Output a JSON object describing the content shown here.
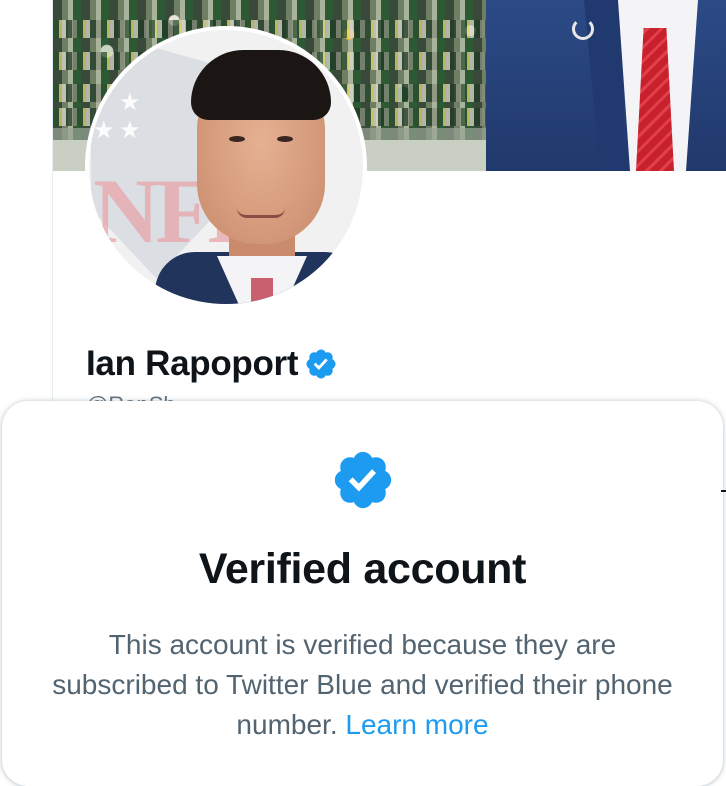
{
  "profile": {
    "name": "Ian Rapoport",
    "handle_partial": "@RapSh"
  },
  "banner": {
    "description": ""
  },
  "avatar": {
    "logo_text": "NFL"
  },
  "verified_card": {
    "title": "Verified account",
    "body": "This account is verified because they are subscribed to Twitter Blue and verified their phone number.",
    "learn_more": "Learn more"
  },
  "colors": {
    "twitter_blue": "#1d9bf0",
    "text_primary": "#0f1419",
    "text_secondary": "#536471"
  },
  "icons": {
    "verified_badge": "verified-check-icon"
  }
}
